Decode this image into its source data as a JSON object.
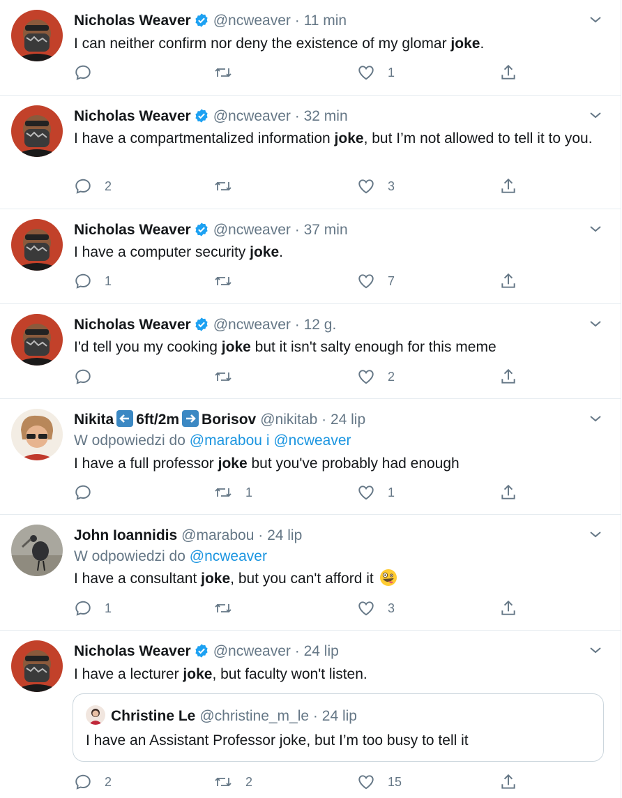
{
  "colors": {
    "text": "#14171a",
    "secondary": "#657786",
    "link": "#1b95e0",
    "border": "#e6ecf0",
    "verified": "#1da1f2"
  },
  "tweets": [
    {
      "name": "Nicholas Weaver",
      "handle": "@ncweaver",
      "time": "11 min",
      "verified": true,
      "text_before": "I can neither confirm nor deny the existence of my glomar ",
      "bold": "joke",
      "text_after": ".",
      "replies": "",
      "retweets": "",
      "likes": "1"
    },
    {
      "name": "Nicholas Weaver",
      "handle": "@ncweaver",
      "time": "32 min",
      "verified": true,
      "text_before": "I have a compartmentalized information ",
      "bold": "joke",
      "text_after": ", but I’m not allowed to tell it to you.",
      "replies": "2",
      "retweets": "",
      "likes": "3"
    },
    {
      "name": "Nicholas Weaver",
      "handle": "@ncweaver",
      "time": "37 min",
      "verified": true,
      "text_before": "I have a computer security ",
      "bold": "joke",
      "text_after": ".",
      "replies": "1",
      "retweets": "",
      "likes": "7"
    },
    {
      "name": "Nicholas Weaver",
      "handle": "@ncweaver",
      "time": "12 g.",
      "verified": true,
      "text_before": "I'd tell you my cooking ",
      "bold": "joke",
      "text_after": " but it isn't salty enough for this meme",
      "replies": "",
      "retweets": "",
      "likes": "2"
    },
    {
      "name_part1": "Nikita",
      "name_part2": "6ft/2m",
      "name_part3": "Borisov",
      "handle": "@nikitab",
      "time": "24 lip",
      "replying_prefix": "W odpowiedzi do",
      "replying_user1": "@marabou",
      "replying_and": "i",
      "replying_user2": "@ncweaver",
      "text_before": "I have a full professor ",
      "bold": "joke",
      "text_after": " but you've probably had enough",
      "replies": "",
      "retweets": "1",
      "likes": "1"
    },
    {
      "name": "John Ioannidis",
      "handle": "@marabou",
      "time": "24 lip",
      "replying_prefix": "W odpowiedzi do",
      "replying_user1": "@ncweaver",
      "text_before": "I have a consultant ",
      "bold": "joke",
      "text_after": ", but you can't afford it",
      "emoji": "zany-face-emoji",
      "replies": "1",
      "retweets": "",
      "likes": "3"
    },
    {
      "name": "Nicholas Weaver",
      "handle": "@ncweaver",
      "time": "24 lip",
      "verified": true,
      "text_before": "I have a lecturer ",
      "bold": "joke",
      "text_after": ", but faculty won't listen.",
      "quote": {
        "name": "Christine Le",
        "handle": "@christine_m_le",
        "time": "24 lip",
        "text": "I have an Assistant Professor joke, but I’m too busy to tell it"
      },
      "replies": "2",
      "retweets": "2",
      "likes": "15"
    }
  ],
  "separator": "·"
}
